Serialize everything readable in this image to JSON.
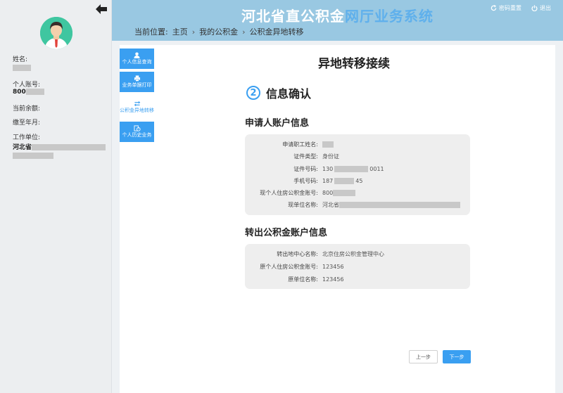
{
  "header": {
    "title_part1": "河北省直公积金",
    "title_part2": "网厅业务系统",
    "change_password": "密码重置",
    "logout": "退出",
    "breadcrumb_prefix": "当前位置:",
    "breadcrumb": [
      "主页",
      "我的公积金",
      "公积金异地转移"
    ]
  },
  "sidebar": {
    "name_label": "姓名:",
    "account_label": "个人账号:",
    "account_value": "800",
    "balance_label": "当前余额:",
    "paid_until_label": "缴至年月:",
    "employer_label": "工作单位:",
    "employer_value": "河北省"
  },
  "nav": [
    {
      "label": "个人信息查询",
      "icon": "user-icon"
    },
    {
      "label": "业务单据打印",
      "icon": "printer-icon"
    },
    {
      "label": "公积金异地转移",
      "icon": "transfer-icon"
    },
    {
      "label": "个人历史业务",
      "icon": "history-icon"
    }
  ],
  "main": {
    "page_title": "异地转移接续",
    "step_number": "2",
    "step_title": "信息确认",
    "applicant_section": "申请人账户信息",
    "applicant_rows": [
      {
        "k": "申请职工姓名:",
        "v": ""
      },
      {
        "k": "证件类型:",
        "v": "身份证"
      },
      {
        "k": "证件号码:",
        "v": "130",
        "v2": "0011"
      },
      {
        "k": "手机号码:",
        "v": "187",
        "v2": "45"
      },
      {
        "k": "现个人住房公积金账号:",
        "v": "800"
      },
      {
        "k": "现单位名称:",
        "v": "河北省"
      }
    ],
    "transfer_section": "转出公积金账户信息",
    "transfer_rows": [
      {
        "k": "转出地中心名称:",
        "v": "北京住房公积金管理中心"
      },
      {
        "k": "原个人住房公积金账号:",
        "v": "123456"
      },
      {
        "k": "原单位名称:",
        "v": "123456"
      }
    ],
    "prev_button": "上一步",
    "next_button": "下一步"
  },
  "colors": {
    "header_bg": "#99c8e2",
    "accent": "#3a9ff1",
    "title_secondary": "#5fb0ec"
  }
}
